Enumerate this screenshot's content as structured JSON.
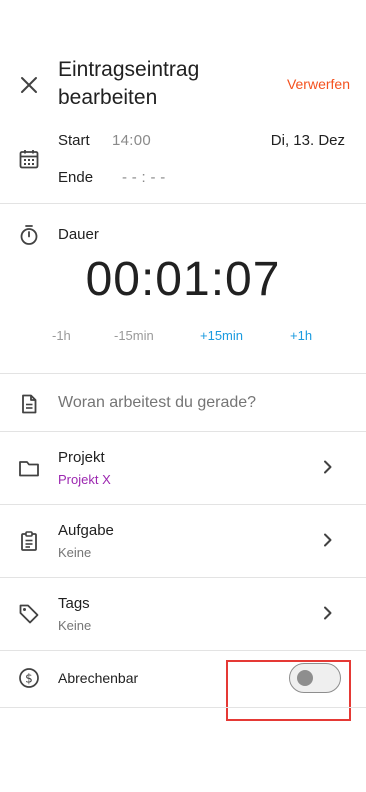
{
  "header": {
    "title": "Eintragseintrag bearbeiten",
    "discard_label": "Verwerfen"
  },
  "time": {
    "start_label": "Start",
    "start_value": "14:00",
    "date_value": "Di, 13. Dez",
    "end_label": "Ende",
    "end_value": "- - : - -"
  },
  "duration": {
    "label": "Dauer",
    "value": "00:01:07",
    "adjust": [
      "-1h",
      "-15min",
      "+15min",
      "+1h"
    ]
  },
  "description": {
    "placeholder": "Woran arbeitest du gerade?"
  },
  "project": {
    "label": "Projekt",
    "value": "Projekt X"
  },
  "task": {
    "label": "Aufgabe",
    "value": "Keine"
  },
  "tags": {
    "label": "Tags",
    "value": "Keine"
  },
  "billable": {
    "label": "Abrechenbar",
    "enabled": false
  },
  "colors": {
    "accent_orange": "#f4511e",
    "accent_blue": "#1a9be0",
    "project_purple": "#9c27b0",
    "highlight_red": "#e53935"
  }
}
